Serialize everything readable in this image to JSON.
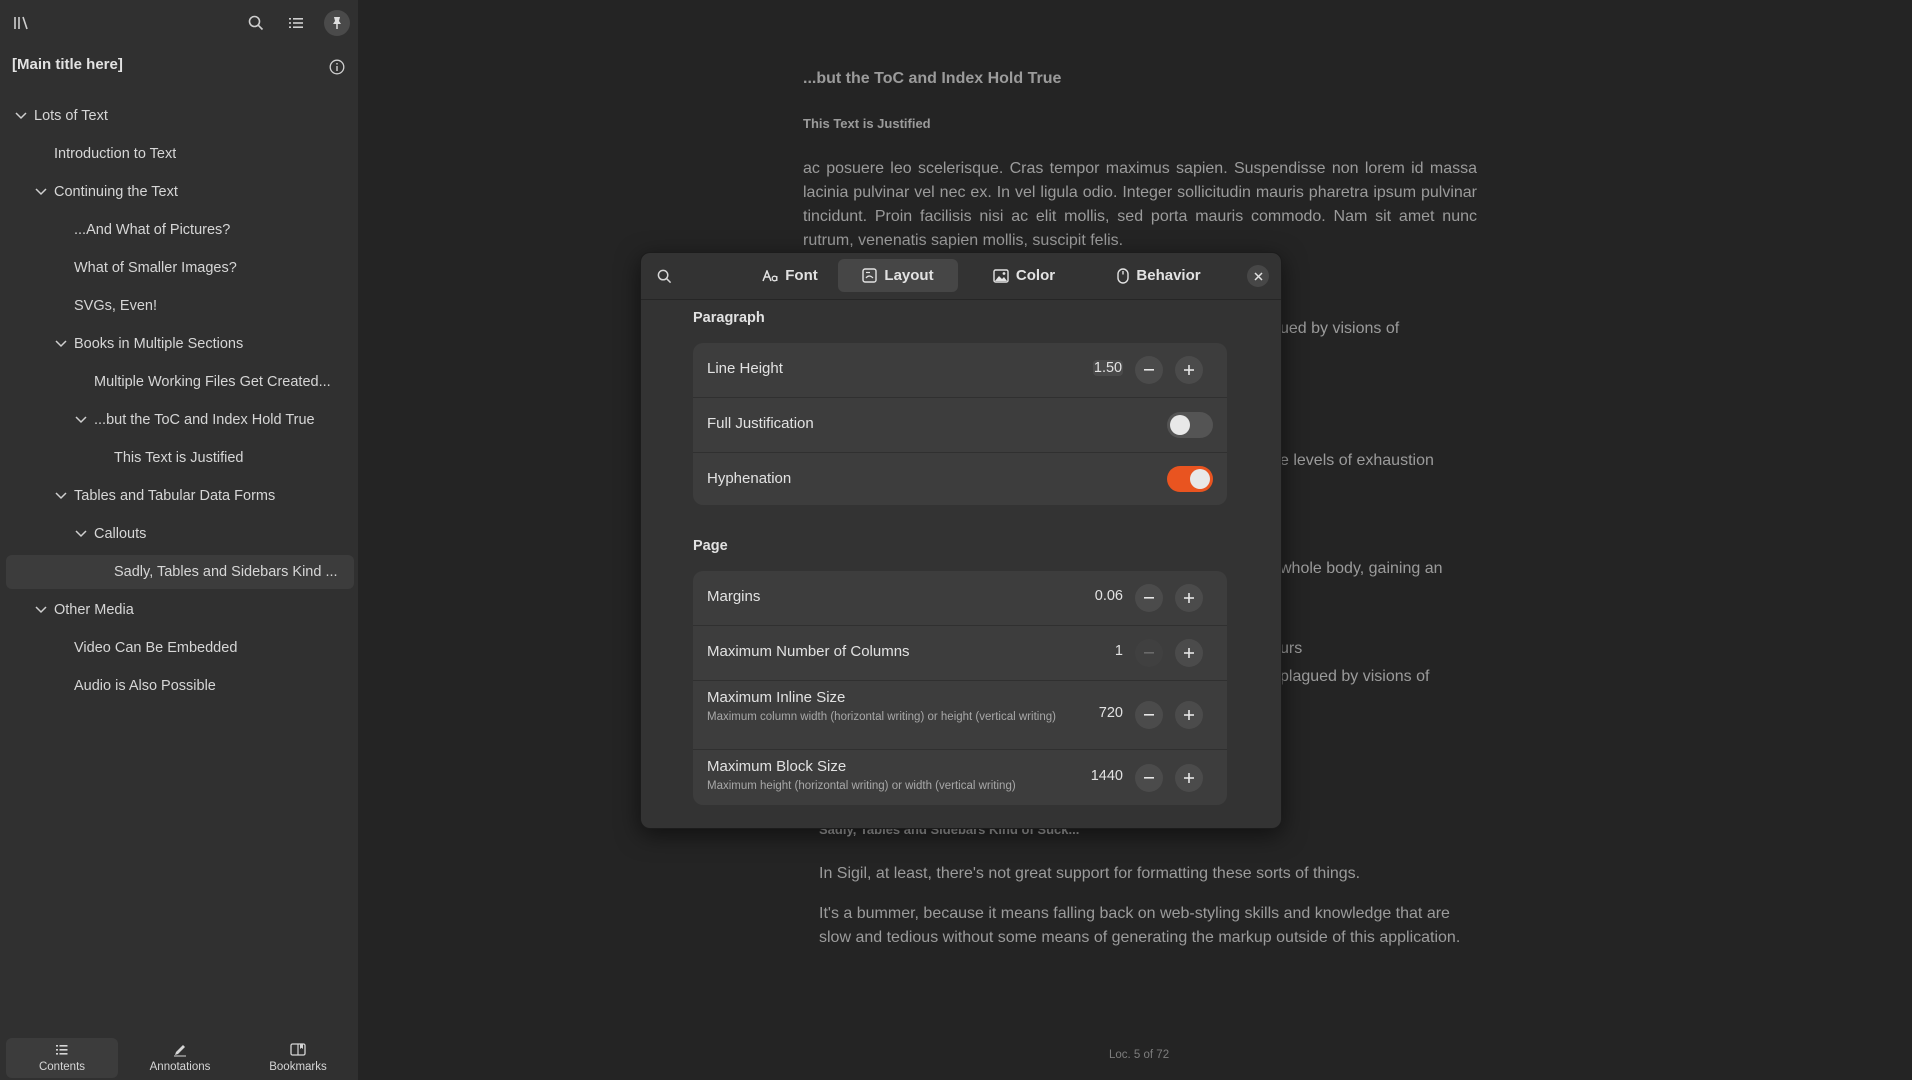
{
  "sidebar": {
    "book_title": "[Main title here]",
    "toc": [
      {
        "label": "Lots of Text"
      },
      {
        "label": "Introduction to Text"
      },
      {
        "label": "Continuing the Text"
      },
      {
        "label": "...And What of Pictures?"
      },
      {
        "label": "What of Smaller Images?"
      },
      {
        "label": "SVGs, Even!"
      },
      {
        "label": "Books in Multiple Sections"
      },
      {
        "label": "Multiple Working Files Get Created..."
      },
      {
        "label": "...but the ToC and Index Hold True"
      },
      {
        "label": "This Text is Justified"
      },
      {
        "label": "Tables and Tabular Data Forms"
      },
      {
        "label": "Callouts"
      },
      {
        "label": "Sadly, Tables and Sidebars Kind ..."
      },
      {
        "label": "Other Media"
      },
      {
        "label": "Video Can Be Embedded"
      },
      {
        "label": "Audio is Also Possible"
      }
    ],
    "footer_tabs": [
      "Contents",
      "Annotations",
      "Bookmarks"
    ]
  },
  "reader": {
    "heading1": "...but the ToC and Index Hold True",
    "heading2": "This Text is Justified",
    "para1": "ac posuere leo scelerisque. Cras tempor maximus sapien. Suspendisse non lorem id massa lacinia pulvinar vel nec ex. In vel ligula odio. Integer sollicitudin mauris pharetra ipsum pulvinar tincidunt. Proin facilisis nisi ac elit mollis, sed porta mauris commodo. Nam sit amet nunc rutrum, venenatis sapien mollis, suscipit felis.",
    "frag1": "ued by visions of",
    "frag2": "e levels of exhaustion",
    "frag3": "whole body, gaining an",
    "frag4": "urs",
    "frag5": "plagued by visions of",
    "heading3": "Sadly, Tables and Sidebars Kind of Suck...",
    "para2": "In Sigil, at least, there's not great support for formatting these sorts of things.",
    "para3": "It's a bummer, because it means falling back on web-styling skills and knowledge that are slow and tedious without some means of generating the markup outside of this application.",
    "location": "Loc. 5 of 72"
  },
  "dialog": {
    "tabs": [
      "Font",
      "Layout",
      "Color",
      "Behavior"
    ],
    "selected_tab": "Layout",
    "paragraph": {
      "title": "Paragraph",
      "line_height_label": "Line Height",
      "line_height_value": "1.50",
      "full_justification_label": "Full Justification",
      "full_justification": false,
      "hyphenation_label": "Hyphenation",
      "hyphenation": true
    },
    "page": {
      "title": "Page",
      "margins_label": "Margins",
      "margins_value": "0.06",
      "columns_label": "Maximum Number of Columns",
      "columns_value": "1",
      "inline_label": "Maximum Inline Size",
      "inline_sub": "Maximum column width (horizontal writing) or height (vertical writing)",
      "inline_value": "720",
      "block_label": "Maximum Block Size",
      "block_sub": "Maximum height (horizontal writing) or width (vertical writing)",
      "block_value": "1440"
    }
  },
  "colors": {
    "accent": "#e95420",
    "sidebar_bg": "#303030",
    "reader_bg": "#242424"
  }
}
